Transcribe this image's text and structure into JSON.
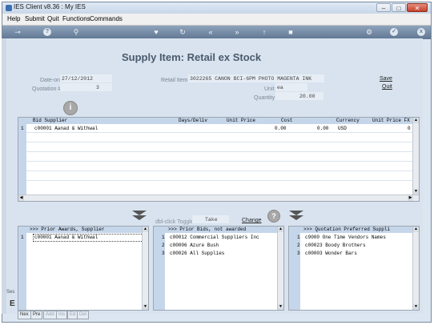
{
  "window": {
    "title": "IES Client v8.36 : My IES"
  },
  "menu": [
    "Help",
    "Submit",
    "Quit",
    "Functions",
    "Commands"
  ],
  "toolbar_icons": [
    "key-icon",
    "help-icon",
    "search-icon",
    "heart-icon",
    "refresh-icon",
    "rewind-icon",
    "fast-forward-icon",
    "upload-icon",
    "stop-icon",
    "gear-icon",
    "check-icon",
    "close-icon"
  ],
  "toolbar_glyphs": {
    "help": "?",
    "check": "✓",
    "close": "x"
  },
  "page": {
    "title": "Supply Item: Retail ex Stock"
  },
  "form": {
    "date_on_label": "Date-on",
    "date_on_value": "27/12/2012",
    "quotation_label": "Quotation #",
    "quotation_value": "3",
    "retail_item_label": "Retail Item",
    "retail_item_value": "3022265 CANON BCI-6PM PHOTO MAGENTA INK",
    "unit_label": "Unit",
    "unit_value": "ea",
    "quantity_label": "Quantity",
    "quantity_value": "20.00"
  },
  "actions": {
    "save": "Save",
    "quit": "Quit"
  },
  "bids_table": {
    "columns": [
      "Bid Supplier",
      "Days/Deliv",
      "Unit Price",
      "Cost",
      "Currency",
      "Unit Price FX"
    ],
    "rows": [
      {
        "n": "1",
        "supplier": "c00001 Aanad & Withwal",
        "days": "",
        "unit_price": "0.00",
        "cost": "0.00",
        "currency": "USD",
        "fx": "0"
      }
    ]
  },
  "middle": {
    "toggle_label": "dbl-click Toggle",
    "take_label": "Take",
    "change_label": "Change"
  },
  "prior_awards": {
    "header": ">>> Prior Awards, Supplier",
    "rows": [
      {
        "n": "1",
        "text": "c00001 Aanad & Withwal"
      }
    ]
  },
  "prior_bids": {
    "header": ">>> Prior Bids, not awarded",
    "rows": [
      {
        "n": "1",
        "text": "c00012 Commercial Suppliers Inc"
      },
      {
        "n": "2",
        "text": "c00006 Azure Bush"
      },
      {
        "n": "3",
        "text": "c00026 All Supplies"
      }
    ]
  },
  "preferred": {
    "header": ">>> Quotation Preferred Suppli",
    "rows": [
      {
        "n": "1",
        "text": "c9000 One Time Vendors Names"
      },
      {
        "n": "2",
        "text": "c00023 Boody Brothers"
      },
      {
        "n": "3",
        "text": "c00003 Wonder Bars"
      }
    ]
  },
  "bottom_tabs": [
    "Nex",
    "Pre",
    "Add",
    "Ins",
    "Ed",
    "Del"
  ],
  "side": {
    "cut_label": "Ses",
    "letter": "E"
  },
  "colors": {
    "accent": "#5f7692",
    "grid_header": "#c6d6ea",
    "background": "#d8e3ef"
  }
}
